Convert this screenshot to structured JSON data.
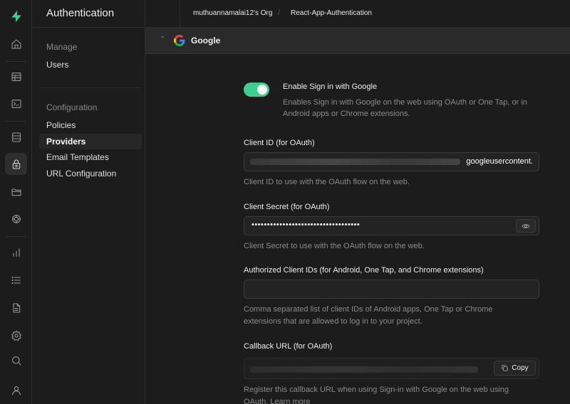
{
  "rail": {
    "logo": "supabase-logo-icon",
    "icons": [
      "home-icon",
      "table-editor-icon",
      "sql-editor-icon",
      "database-icon",
      "authentication-icon",
      "storage-icon",
      "edge-functions-icon",
      "reports-icon",
      "logs-icon",
      "api-docs-icon",
      "settings-icon",
      "search-icon",
      "user-icon"
    ],
    "accent_color": "#3ecf8e"
  },
  "menu": {
    "title": "Authentication",
    "groups": [
      {
        "label": "Manage",
        "items": [
          {
            "label": "Users"
          }
        ]
      },
      {
        "label": "Configuration",
        "items": [
          {
            "label": "Policies"
          },
          {
            "label": "Providers",
            "active": true
          },
          {
            "label": "Email Templates"
          },
          {
            "label": "URL Configuration"
          }
        ]
      }
    ]
  },
  "breadcrumb": {
    "org": "muthuannamalai12's Org",
    "separator": "/",
    "project": "React-App-Authentication"
  },
  "provider": {
    "name": "Google",
    "enabled": true,
    "enable_label": "Enable Sign in with Google",
    "enable_desc_1": "Enables Sign in with Google on the web using OAuth or One Tap, or in",
    "enable_desc_2": "Android apps or Chrome extensions.",
    "client_id": {
      "label": "Client ID (for OAuth)",
      "value_tail": "googleusercontent.",
      "desc": "Client ID to use with the OAuth flow on the web."
    },
    "client_secret": {
      "label": "Client Secret (for OAuth)",
      "value_masked": "•••••••••••••••••••••••••••••••••••",
      "desc": "Client Secret to use with the OAuth flow on the web."
    },
    "authorized_ids": {
      "label": "Authorized Client IDs (for Android, One Tap, and Chrome extensions)",
      "value": "",
      "desc_1": "Comma separated list of client IDs of Android apps, One Tap or Chrome",
      "desc_2": "extensions that are allowed to log in to your project."
    },
    "callback": {
      "label": "Callback URL (for OAuth)",
      "copy_label": "Copy",
      "desc_1": "Register this callback URL when using Sign-in with Google on the web using",
      "desc_2": "OAuth. Learn more"
    }
  }
}
